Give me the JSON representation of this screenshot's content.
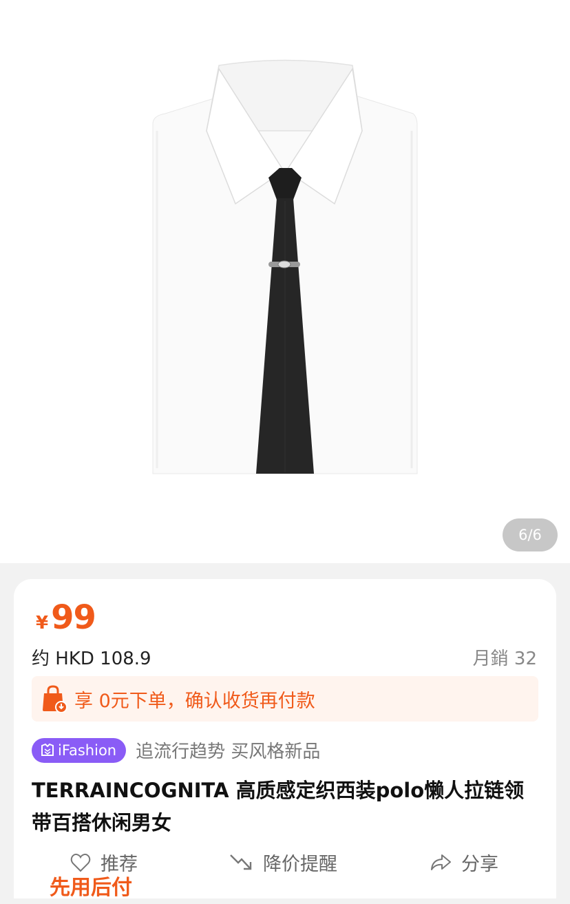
{
  "gallery": {
    "counter": "6/6"
  },
  "price": {
    "currency": "¥",
    "amount": "99",
    "converted": "约 HKD 108.9",
    "monthly_sales": "月銷 32"
  },
  "paylater": {
    "icon": "shopping-bag-icon",
    "title": "先用后付",
    "desc": "享 0元下单，确认收货再付款"
  },
  "tag": {
    "badge": "iFashion",
    "slogan": "追流行趋势 买风格新品"
  },
  "product": {
    "title": "TERRAINCOGNITA 高质感定织西装polo懒人拉链领带百搭休闲男女"
  },
  "actions": [
    {
      "label": "推荐",
      "icon": "heart-icon"
    },
    {
      "label": "降价提醒",
      "icon": "trend-down-icon"
    },
    {
      "label": "分享",
      "icon": "share-icon"
    }
  ],
  "colors": {
    "accent": "#f05a1a",
    "ifashion": "#8a5cf6"
  }
}
